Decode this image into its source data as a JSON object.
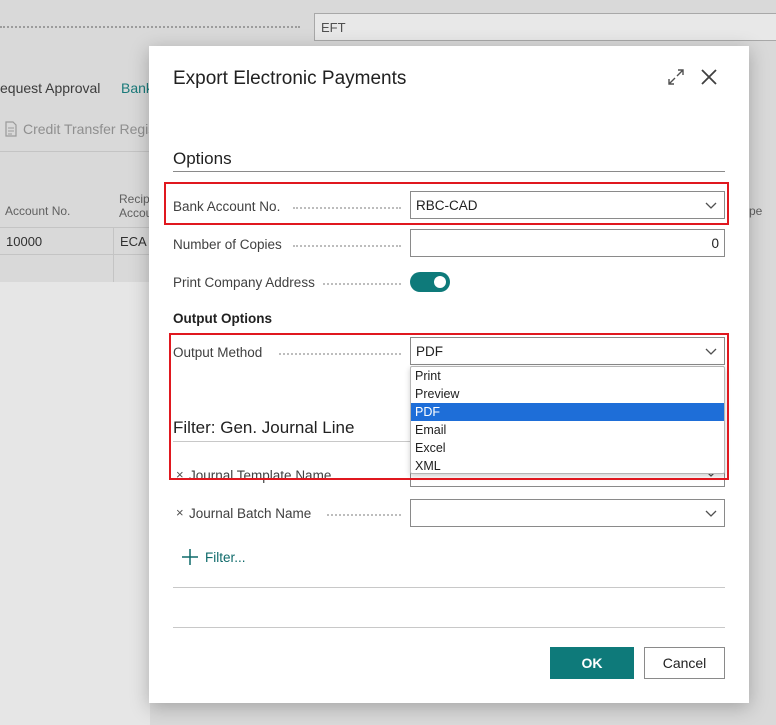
{
  "background": {
    "field_value": "EFT",
    "tabs": [
      "equest Approval",
      "Bank"
    ],
    "action": "Credit Transfer Regis",
    "columns": [
      "Account No.",
      "Recip",
      "Accou"
    ],
    "right_col": "pe",
    "row": {
      "account_no": "10000",
      "recipient": "ECA"
    }
  },
  "dialog": {
    "title": "Export Electronic Payments",
    "options_heading": "Options",
    "bank_account_label": "Bank Account No.",
    "bank_account_value": "RBC-CAD",
    "copies_label": "Number of Copies",
    "copies_value": "0",
    "print_address_label": "Print Company Address",
    "print_address_on": true,
    "output_options_heading": "Output Options",
    "output_method_label": "Output Method",
    "output_method_value": "PDF",
    "output_method_options": [
      "Print",
      "Preview",
      "PDF",
      "Email",
      "Excel",
      "XML"
    ],
    "filter_heading": "Filter: Gen. Journal Line",
    "journal_template_label": "Journal Template Name",
    "journal_batch_label": "Journal Batch Name",
    "add_filter_label": "Filter...",
    "ok_label": "OK",
    "cancel_label": "Cancel"
  },
  "colors": {
    "accent": "#0e7a7a",
    "selection": "#1e6ed8",
    "highlight": "#e0181f"
  }
}
